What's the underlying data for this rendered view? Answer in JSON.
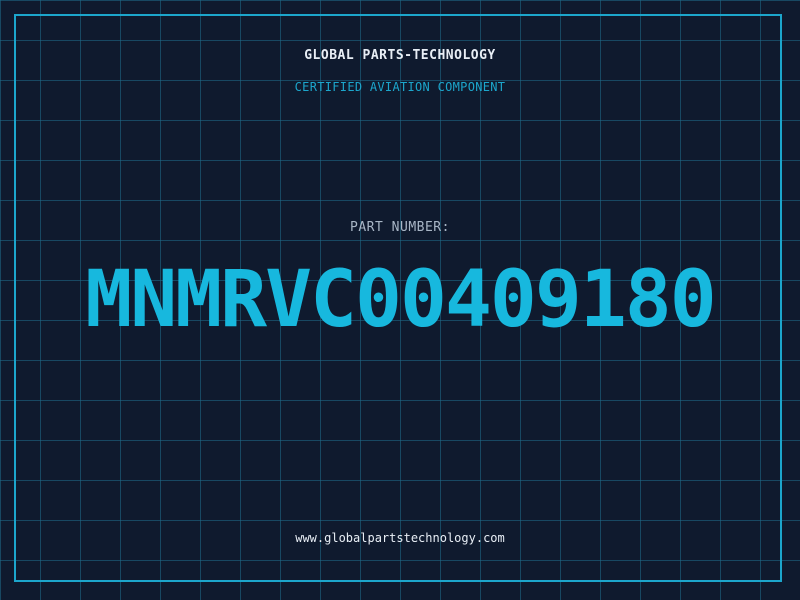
{
  "label": {
    "company": "GLOBAL PARTS-TECHNOLOGY",
    "subtitle": "CERTIFIED AVIATION COMPONENT",
    "part_number_label": "PART NUMBER:",
    "part_number": "MNMRVC00409180",
    "website": "www.globalpartstechnology.com"
  },
  "colors": {
    "background": "#0f1a2e",
    "grid": "#1e6e8c",
    "accent": "#17b8de",
    "text": "#e8eef5"
  }
}
